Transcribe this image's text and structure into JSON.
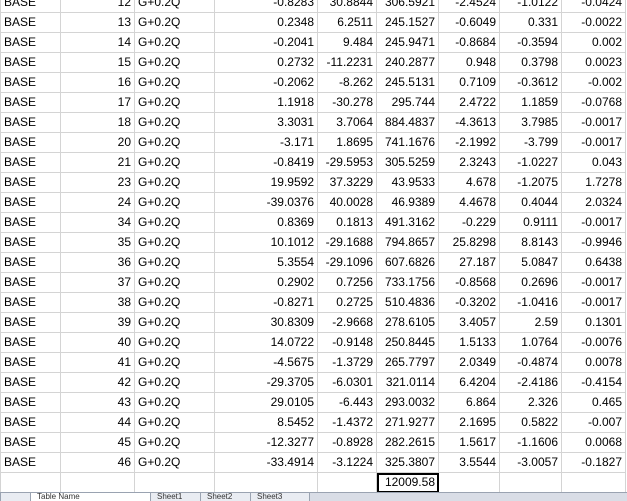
{
  "sheet": {
    "rows": [
      [
        "BASE",
        "12",
        "G+0.2Q",
        "-0.8283",
        "30.8844",
        "306.5921",
        "-2.4524",
        "-1.0122",
        "-0.0424"
      ],
      [
        "BASE",
        "13",
        "G+0.2Q",
        "0.2348",
        "6.2511",
        "245.1527",
        "-0.6049",
        "0.331",
        "-0.0022"
      ],
      [
        "BASE",
        "14",
        "G+0.2Q",
        "-0.2041",
        "9.484",
        "245.9471",
        "-0.8684",
        "-0.3594",
        "0.002"
      ],
      [
        "BASE",
        "15",
        "G+0.2Q",
        "0.2732",
        "-11.2231",
        "240.2877",
        "0.948",
        "0.3798",
        "0.0023"
      ],
      [
        "BASE",
        "16",
        "G+0.2Q",
        "-0.2062",
        "-8.262",
        "245.5131",
        "0.7109",
        "-0.3612",
        "-0.002"
      ],
      [
        "BASE",
        "17",
        "G+0.2Q",
        "1.1918",
        "-30.278",
        "295.744",
        "2.4722",
        "1.1859",
        "-0.0768"
      ],
      [
        "BASE",
        "18",
        "G+0.2Q",
        "3.3031",
        "3.7064",
        "884.4837",
        "-4.3613",
        "3.7985",
        "-0.0017"
      ],
      [
        "BASE",
        "20",
        "G+0.2Q",
        "-3.171",
        "1.8695",
        "741.1676",
        "-2.1992",
        "-3.799",
        "-0.0017"
      ],
      [
        "BASE",
        "21",
        "G+0.2Q",
        "-0.8419",
        "-29.5953",
        "305.5259",
        "2.3243",
        "-1.0227",
        "0.043"
      ],
      [
        "BASE",
        "23",
        "G+0.2Q",
        "19.9592",
        "37.3229",
        "43.9533",
        "4.678",
        "-1.2075",
        "1.7278"
      ],
      [
        "BASE",
        "24",
        "G+0.2Q",
        "-39.0376",
        "40.0028",
        "46.9389",
        "4.4678",
        "0.4044",
        "2.0324"
      ],
      [
        "BASE",
        "34",
        "G+0.2Q",
        "0.8369",
        "0.1813",
        "491.3162",
        "-0.229",
        "0.9111",
        "-0.0017"
      ],
      [
        "BASE",
        "35",
        "G+0.2Q",
        "10.1012",
        "-29.1688",
        "794.8657",
        "25.8298",
        "8.8143",
        "-0.9946"
      ],
      [
        "BASE",
        "36",
        "G+0.2Q",
        "5.3554",
        "-29.1096",
        "607.6826",
        "27.187",
        "5.0847",
        "0.6438"
      ],
      [
        "BASE",
        "37",
        "G+0.2Q",
        "0.2902",
        "0.7256",
        "733.1756",
        "-0.8568",
        "0.2696",
        "-0.0017"
      ],
      [
        "BASE",
        "38",
        "G+0.2Q",
        "-0.8271",
        "0.2725",
        "510.4836",
        "-0.3202",
        "-1.0416",
        "-0.0017"
      ],
      [
        "BASE",
        "39",
        "G+0.2Q",
        "30.8309",
        "-2.9668",
        "278.6105",
        "3.4057",
        "2.59",
        "0.1301"
      ],
      [
        "BASE",
        "40",
        "G+0.2Q",
        "14.0722",
        "-0.9148",
        "250.8445",
        "1.5133",
        "1.0764",
        "-0.0076"
      ],
      [
        "BASE",
        "41",
        "G+0.2Q",
        "-4.5675",
        "-1.3729",
        "265.7797",
        "2.0349",
        "-0.4874",
        "0.0078"
      ],
      [
        "BASE",
        "42",
        "G+0.2Q",
        "-29.3705",
        "-6.0301",
        "321.0114",
        "6.4204",
        "-2.4186",
        "-0.4154"
      ],
      [
        "BASE",
        "43",
        "G+0.2Q",
        "29.0105",
        "-6.443",
        "293.0032",
        "6.864",
        "2.326",
        "0.465"
      ],
      [
        "BASE",
        "44",
        "G+0.2Q",
        "8.5452",
        "-1.4372",
        "271.9277",
        "2.1695",
        "0.5822",
        "-0.007"
      ],
      [
        "BASE",
        "45",
        "G+0.2Q",
        "-12.3277",
        "-0.8928",
        "282.2615",
        "1.5617",
        "-1.1606",
        "0.0068"
      ],
      [
        "BASE",
        "46",
        "G+0.2Q",
        "-33.4914",
        "-3.1224",
        "325.3807",
        "3.5544",
        "-3.0057",
        "-0.1827"
      ]
    ],
    "total_value": "12009.58"
  },
  "tabs": [
    "Table Name",
    "Sheet1",
    "Sheet2",
    "Sheet3"
  ]
}
